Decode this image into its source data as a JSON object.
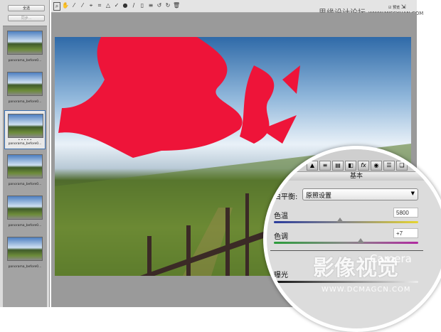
{
  "left_panel": {
    "select_all": "全选",
    "sync": "同步...",
    "thumbnails": [
      {
        "name": "panorama_before0..."
      },
      {
        "name": "panorama_before0..."
      },
      {
        "name": "panorama_before0...",
        "selected": true,
        "rating": "• • • • •"
      },
      {
        "name": "panorama_before0..."
      },
      {
        "name": "panorama_before0..."
      },
      {
        "name": "panorama_before0..."
      }
    ]
  },
  "toolbar": {
    "icons": [
      "zoom-icon",
      "hand-icon",
      "white-balance-icon",
      "color-sampler-icon",
      "target-adjust-icon",
      "crop-icon",
      "straighten-icon",
      "spot-removal-icon",
      "red-eye-icon",
      "brush-icon",
      "graduated-filter-icon",
      "list-icon",
      "rotate-ccw-icon",
      "rotate-cw-icon",
      "trash-icon"
    ]
  },
  "preview": {
    "label": "预览",
    "checked": true
  },
  "panel": {
    "section": "基本",
    "white_balance_label": "白平衡:",
    "white_balance_value": "原照设置",
    "temp_label": "色温",
    "temp_value": "5800",
    "tint_label": "色调",
    "tint_value": "+7",
    "exposure_label": "曝光",
    "temp_fraction": 0.46,
    "tint_fraction": 0.6
  },
  "watermarks": {
    "site1": "思缘设计论坛",
    "site1_url": "WWW.MISSYUAN.COM",
    "site2": "影像视觉",
    "site2_en": "Camera",
    "site2_url": "WWW.DCMAGCN.COM"
  }
}
